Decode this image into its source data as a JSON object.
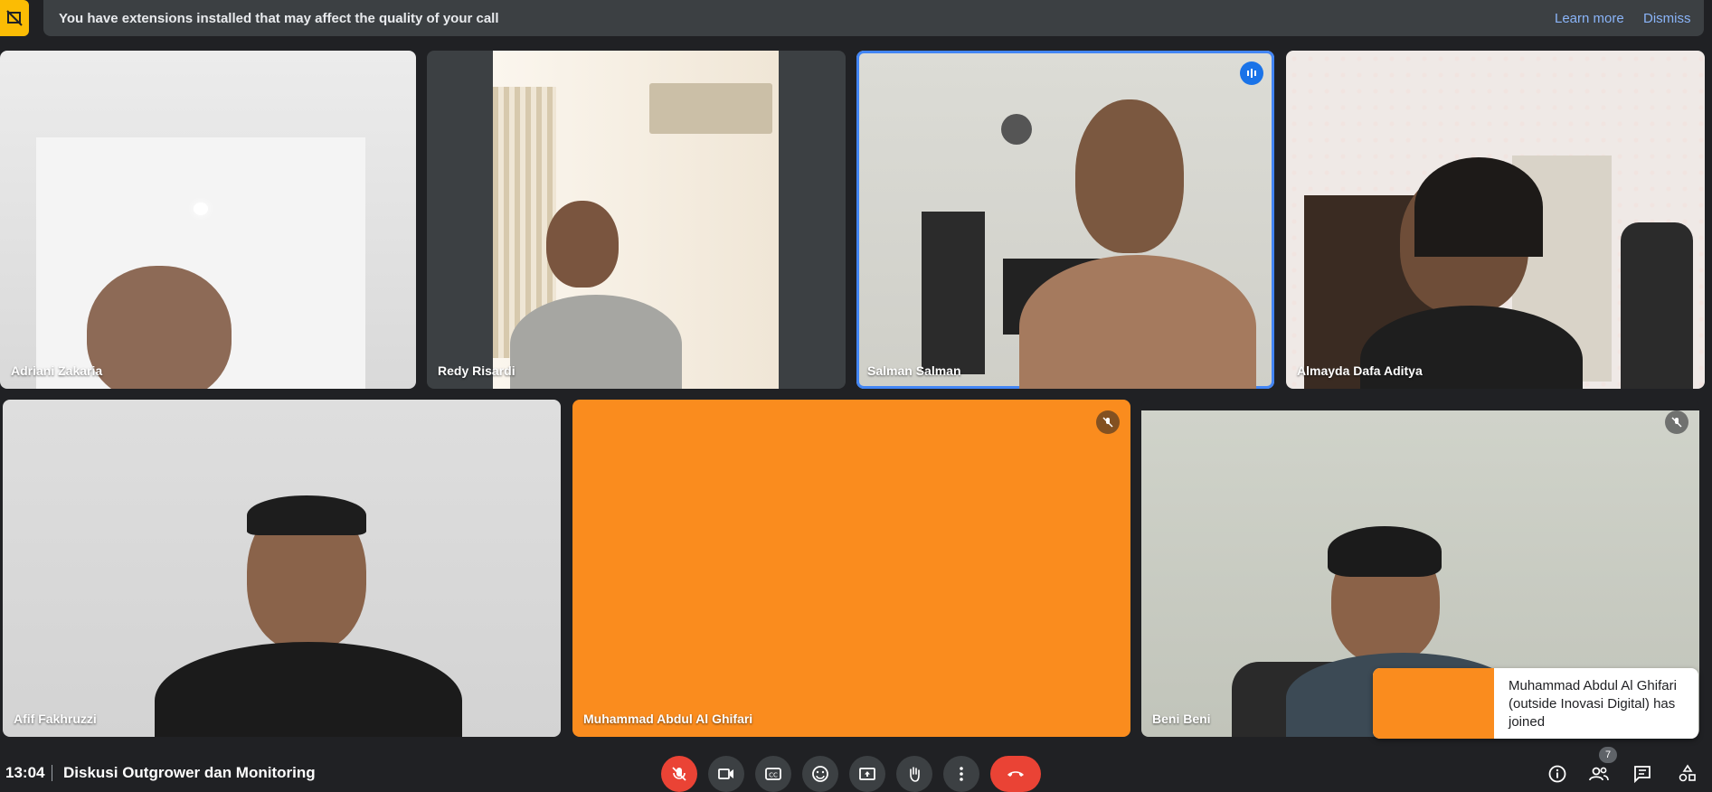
{
  "banner": {
    "message": "You have extensions installed that may affect the quality of your call",
    "learn_more": "Learn more",
    "dismiss": "Dismiss",
    "accent": "#fbbc04"
  },
  "participants": [
    {
      "name": "Adriani Zakaria"
    },
    {
      "name": "Redy Risardi"
    },
    {
      "name": "Salman Salman",
      "speaking": true
    },
    {
      "name": "Almayda Dafa Aditya"
    },
    {
      "name": "Afif Fakhruzzi"
    },
    {
      "name": "Muhammad Abdul Al Ghifari",
      "muted": true,
      "video_off": true
    },
    {
      "name": "Beni Beni",
      "muted": true
    }
  ],
  "toast": {
    "text": "Muhammad Abdul Al Ghifari (outside Inovasi Digital) has joined"
  },
  "footer": {
    "time": "13:04",
    "meeting_title": "Diskusi Outgrower dan Monitoring",
    "people_count": "7"
  },
  "controls": [
    {
      "icon": "mic-off-icon",
      "state": "muted"
    },
    {
      "icon": "camera-icon"
    },
    {
      "icon": "captions-icon"
    },
    {
      "icon": "emoji-icon"
    },
    {
      "icon": "present-screen-icon"
    },
    {
      "icon": "raise-hand-icon"
    },
    {
      "icon": "more-options-icon"
    },
    {
      "icon": "hang-up-icon"
    }
  ],
  "colors": {
    "background": "#202124",
    "speaking_border": "#4285f4",
    "video_off_tile": "#fa8c1e",
    "hangup": "#ea4335"
  }
}
